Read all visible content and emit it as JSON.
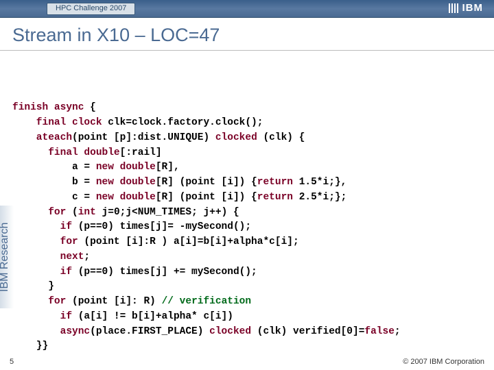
{
  "header": {
    "tab": "HPC Challenge 2007",
    "logo_text": "IBM"
  },
  "title": "Stream in X10 – LOC=47",
  "code": {
    "l1a": "finish async",
    "l1b": " {",
    "l2a": "    final clock",
    "l2b": " clk=clock.factory.clock();",
    "l3a": "    ateach",
    "l3b": "(point [p]:dist.UNIQUE) ",
    "l3c": "clocked",
    "l3d": " (clk) {",
    "l4a": "      final double",
    "l4b": "[:rail]",
    "l5a": "          a = ",
    "l5b": "new double",
    "l5c": "[R],",
    "l6a": "          b = ",
    "l6b": "new double",
    "l6c": "[R] (point [i]) {",
    "l6d": "return",
    "l6e": " 1.5*i;},",
    "l7a": "          c = ",
    "l7b": "new double",
    "l7c": "[R] (point [i]) {",
    "l7d": "return",
    "l7e": " 2.5*i;};",
    "l8a": "      for",
    "l8b": " (",
    "l8c": "int",
    "l8d": " j=0;j<NUM_TIMES; j++) {",
    "l9a": "        if",
    "l9b": " (p==0) times[j]= -mySecond();",
    "l10a": "        for",
    "l10b": " (point [i]:R ) a[i]=b[i]+alpha*c[i];",
    "l11a": "        next",
    "l11b": ";",
    "l12a": "        if",
    "l12b": " (p==0) times[j] += mySecond();",
    "l13": "      }",
    "l14a": "      for",
    "l14b": " (point [i]: R) ",
    "l14c": "// verification",
    "l15a": "        if",
    "l15b": " (a[i] != b[i]+alpha* c[i])",
    "l16a": "        async",
    "l16b": "(place.FIRST_PLACE) ",
    "l16c": "clocked",
    "l16d": " (clk) verified[0]=",
    "l16e": "false",
    "l16f": ";",
    "l17": "    }}"
  },
  "side_label": "IBM Research",
  "footer": {
    "page": "5",
    "copyright": "© 2007 IBM Corporation"
  }
}
